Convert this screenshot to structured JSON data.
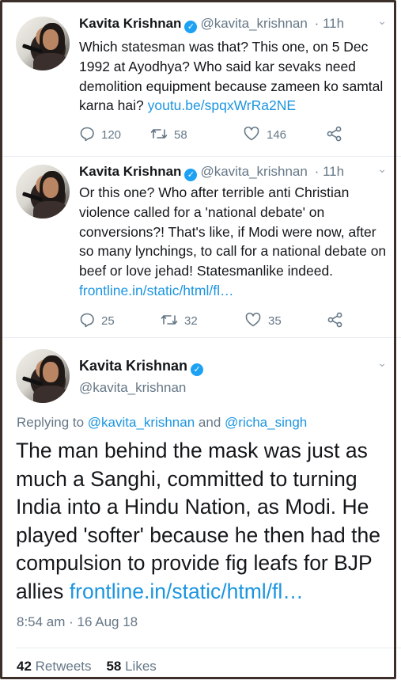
{
  "tweets": [
    {
      "name": "Kavita Krishnan",
      "handle": "@kavita_krishnan",
      "time": "· 11h",
      "text": "Which statesman was that? This one, on 5 Dec 1992 at Ayodhya? Who said kar sevaks need demolition equipment because zameen ko samtal karna hai?",
      "link": "youtu.be/spqxWrRa2NE",
      "replies": "120",
      "retweets": "58",
      "likes": "146"
    },
    {
      "name": "Kavita Krishnan",
      "handle": "@kavita_krishnan",
      "time": "· 11h",
      "text": "Or this one? Who after terrible anti Christian violence called for a 'national debate' on conversions?! That's like, if Modi were now, after so many lynchings, to call for a national debate on beef or love jehad! Statesmanlike indeed.",
      "link": "frontline.in/static/html/fl…",
      "replies": "25",
      "retweets": "32",
      "likes": "35"
    }
  ],
  "main": {
    "name": "Kavita Krishnan",
    "handle": "@kavita_krishnan",
    "replying_prefix": "Replying to",
    "replying_user1": "@kavita_krishnan",
    "replying_and": "and",
    "replying_user2": "@richa_singh",
    "text": "The man behind the mask was just as much a Sanghi, committed to turning India into a Hindu Nation, as Modi. He played 'softer' because he then had the compulsion to provide fig leafs for BJP allies",
    "link": "frontline.in/static/html/fl…",
    "timestamp": "8:54 am · 16 Aug 18",
    "retweets_count": "42",
    "retweets_label": "Retweets",
    "likes_count": "58",
    "likes_label": "Likes"
  },
  "icons": {
    "verified": "✓",
    "chevron": "⌄"
  },
  "colors": {
    "link": "#1b95e0",
    "verified": "#1da1f2",
    "muted": "#657786"
  }
}
